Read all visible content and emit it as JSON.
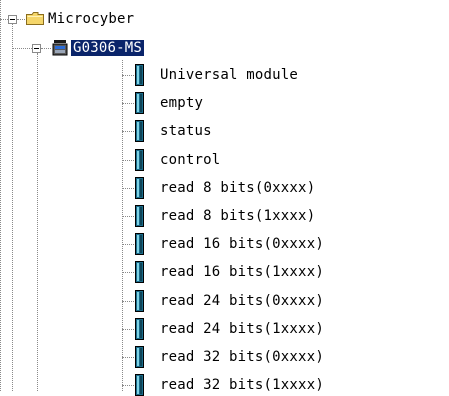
{
  "tree": {
    "root": {
      "label": "Microcyber",
      "icon": "folder-icon",
      "expanded": true
    },
    "device": {
      "label": "G0306-MS",
      "icon": "device-icon",
      "selected": true,
      "expanded": true
    },
    "modules": [
      {
        "label": "Universal module",
        "icon": "module-icon"
      },
      {
        "label": "empty",
        "icon": "module-icon"
      },
      {
        "label": "status",
        "icon": "module-icon"
      },
      {
        "label": "control",
        "icon": "module-icon"
      },
      {
        "label": "read 8 bits(0xxxx)",
        "icon": "module-icon"
      },
      {
        "label": "read 8 bits(1xxxx)",
        "icon": "module-icon"
      },
      {
        "label": "read 16 bits(0xxxx)",
        "icon": "module-icon"
      },
      {
        "label": "read 16 bits(1xxxx)",
        "icon": "module-icon"
      },
      {
        "label": "read 24 bits(0xxxx)",
        "icon": "module-icon"
      },
      {
        "label": "read 24 bits(1xxxx)",
        "icon": "module-icon"
      },
      {
        "label": "read 32 bits(0xxxx)",
        "icon": "module-icon"
      },
      {
        "label": "read 32 bits(1xxxx)",
        "icon": "module-icon"
      }
    ],
    "colors": {
      "selection": "#0a246a",
      "folder": "#f5d66a",
      "module": "#1a6b8a"
    }
  }
}
